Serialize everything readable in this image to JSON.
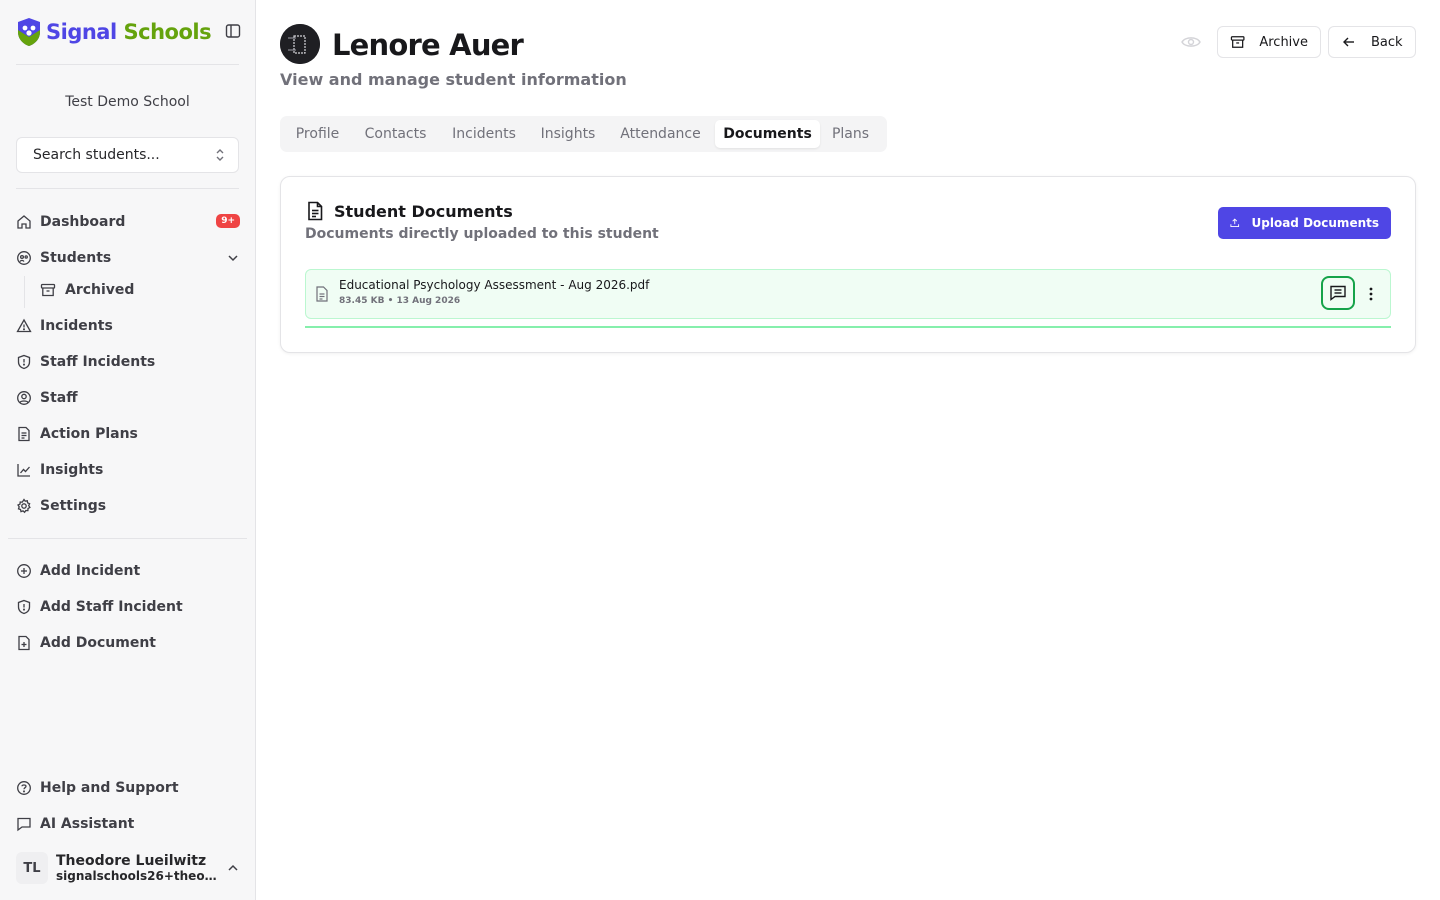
{
  "brand": {
    "part1": "Signal",
    "part2": "Schools",
    "primary_color": "#4f46e5",
    "secondary_color": "#65a30d"
  },
  "sidebar": {
    "school_name": "Test Demo School",
    "search_label": "Search students...",
    "nav": [
      {
        "label": "Dashboard",
        "icon": "home-icon",
        "badge": "9+"
      },
      {
        "label": "Students",
        "icon": "students-icon",
        "expanded": true
      },
      {
        "label": "Archived",
        "icon": "archive-icon"
      },
      {
        "label": "Incidents",
        "icon": "warning-triangle-icon"
      },
      {
        "label": "Staff Incidents",
        "icon": "shield-alert-icon"
      },
      {
        "label": "Staff",
        "icon": "user-circle-icon"
      },
      {
        "label": "Action Plans",
        "icon": "document-icon"
      },
      {
        "label": "Insights",
        "icon": "line-chart-icon"
      },
      {
        "label": "Settings",
        "icon": "gear-icon"
      }
    ],
    "quick_actions": [
      {
        "label": "Add Incident",
        "icon": "plus-circle-icon"
      },
      {
        "label": "Add Staff Incident",
        "icon": "shield-alert-icon"
      },
      {
        "label": "Add Document",
        "icon": "file-plus-icon"
      }
    ],
    "footer": [
      {
        "label": "Help and Support",
        "icon": "help-circle-icon"
      },
      {
        "label": "AI Assistant",
        "icon": "chat-icon"
      }
    ],
    "user": {
      "initials": "TL",
      "name": "Theodore Lueilwitz",
      "email": "signalschools26+theodo..."
    }
  },
  "header": {
    "title": "Lenore Auer",
    "subtitle": "View and manage student information",
    "archive_label": "Archive",
    "back_label": "Back"
  },
  "tabs": [
    {
      "label": "Profile",
      "active": false
    },
    {
      "label": "Contacts",
      "active": false
    },
    {
      "label": "Incidents",
      "active": false
    },
    {
      "label": "Insights",
      "active": false
    },
    {
      "label": "Attendance",
      "active": false
    },
    {
      "label": "Documents",
      "active": true
    },
    {
      "label": "Plans",
      "active": false
    }
  ],
  "documents": {
    "title": "Student Documents",
    "subtitle": "Documents directly uploaded to this student",
    "upload_label": "Upload Documents",
    "items": [
      {
        "name": "Educational Psychology Assessment - Aug 2026.pdf",
        "size": "83.45 KB",
        "date": "13 Aug 2026",
        "meta": "83.45 KB • 13 Aug 2026"
      }
    ]
  }
}
